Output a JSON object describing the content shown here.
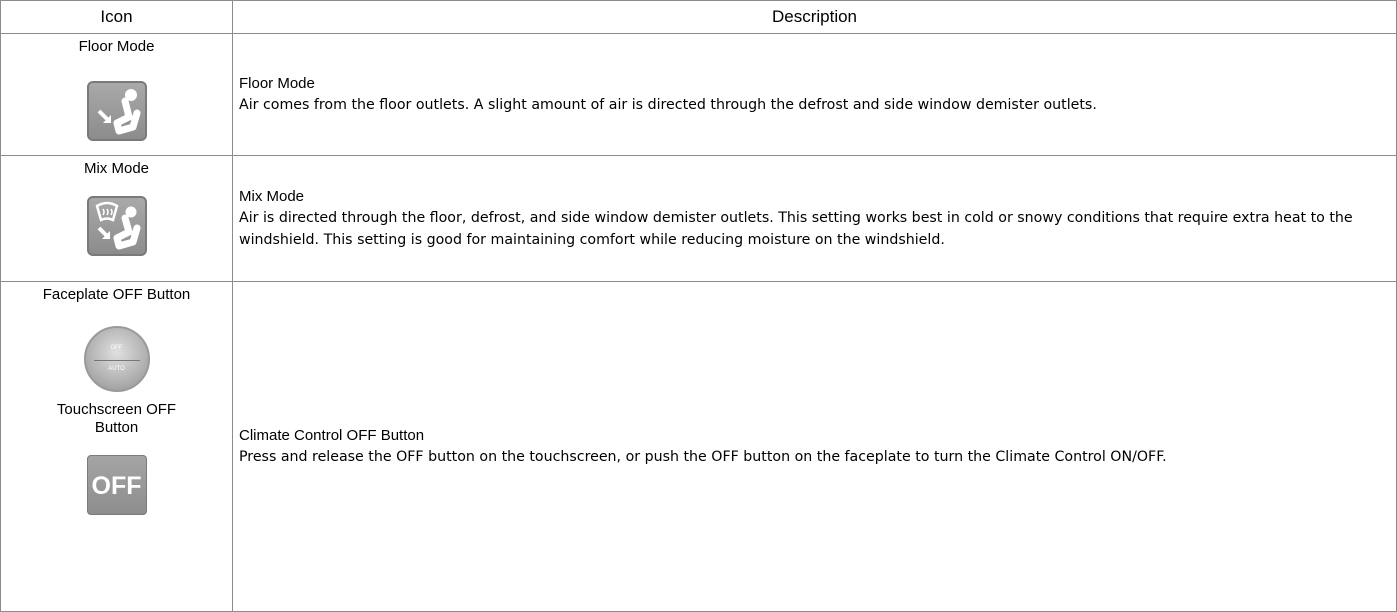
{
  "header": {
    "icon": "Icon",
    "description": "Description"
  },
  "rows": [
    {
      "icon_label": "Floor Mode",
      "icon": "floor-mode-icon",
      "title": "Floor Mode",
      "text": "Air comes from the floor outlets. A slight amount of air is directed through the defrost and side window demister outlets."
    },
    {
      "icon_label": "Mix Mode",
      "icon": "mix-mode-icon",
      "title": "Mix Mode",
      "text": "Air is directed through the floor, defrost, and side window demister outlets. This setting works best in cold or snowy conditions that require extra heat to the windshield. This setting is good for maintaining comfort while reducing moisture on the windshield."
    },
    {
      "icon_label": "Faceplate OFF Button",
      "icon_label2": "Touchscreen OFF Button",
      "knob_off": "OFF",
      "knob_auto": "AUTO",
      "off_button": "OFF",
      "title": "Climate Control OFF Button",
      "text": "Press and release the OFF button on the touchscreen, or push the OFF button on the faceplate to turn the Climate Control ON/OFF."
    }
  ]
}
